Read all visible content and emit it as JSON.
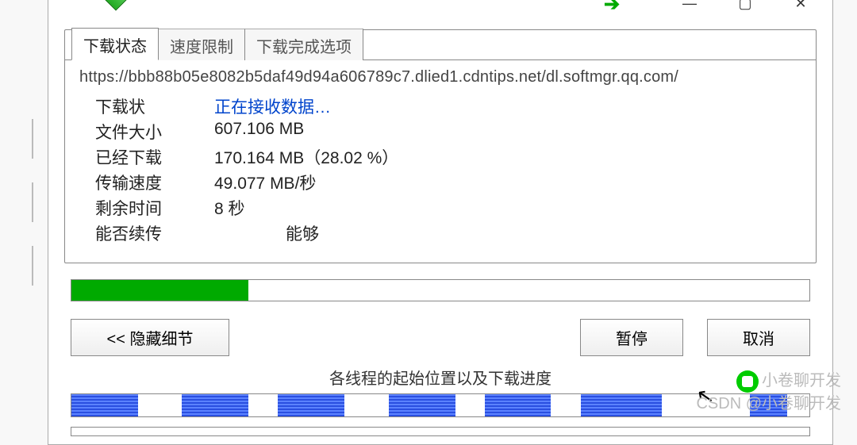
{
  "tabs": {
    "status": "下载状态",
    "speed": "速度限制",
    "complete": "下载完成选项"
  },
  "url": "https://bbb88b05e8082b5daf49d94a606789c7.dlied1.cdntips.net/dl.softmgr.qq.com/",
  "labels": {
    "status": "下载状",
    "filesize": "文件大小",
    "downloaded": "已经下载",
    "speed": "传输速度",
    "remaining": "剩余时间",
    "resumable": "能否续传"
  },
  "values": {
    "status": "正在接收数据…",
    "filesize": "607.106  MB",
    "downloaded": "170.164  MB（28.02 %）",
    "speed": "49.077  MB/秒",
    "remaining": "8 秒",
    "resumable": "能够"
  },
  "progress_percent": 24,
  "buttons": {
    "hide": "<< 隐藏细节",
    "pause": "暂停",
    "cancel": "取消"
  },
  "thread_title": "各线程的起始位置以及下载进度",
  "thread_segments": [
    {
      "kind": "blue",
      "w": 9
    },
    {
      "kind": "white",
      "w": 6
    },
    {
      "kind": "blue",
      "w": 9
    },
    {
      "kind": "white",
      "w": 4
    },
    {
      "kind": "blue",
      "w": 9
    },
    {
      "kind": "white",
      "w": 6
    },
    {
      "kind": "blue",
      "w": 9
    },
    {
      "kind": "white",
      "w": 4
    },
    {
      "kind": "blue",
      "w": 9
    },
    {
      "kind": "white",
      "w": 4
    },
    {
      "kind": "blue",
      "w": 11
    },
    {
      "kind": "white",
      "w": 12
    },
    {
      "kind": "blue",
      "w": 5
    },
    {
      "kind": "white",
      "w": 3
    }
  ],
  "watermark": {
    "line1": "小卷聊开发",
    "line2": "CSDN @小卷聊开发"
  }
}
